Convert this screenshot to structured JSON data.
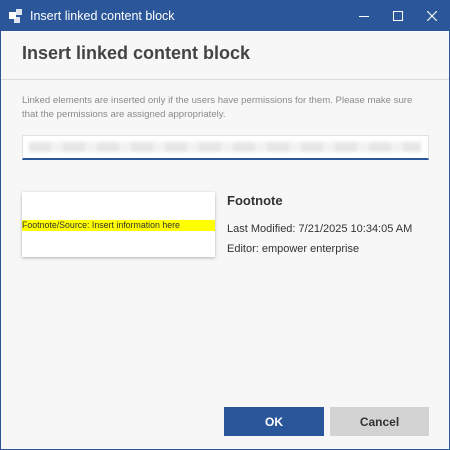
{
  "window": {
    "title": "Insert linked content block",
    "controls": [
      "minimize-icon",
      "maximize-icon",
      "close-icon"
    ]
  },
  "dialog": {
    "heading": "Insert linked content block",
    "info": "Linked elements are inserted only if the users have permissions for them. Please make sure that the permissions are assigned appropriately."
  },
  "search": {
    "value": ""
  },
  "block": {
    "preview_text": "Footnote/Source: Insert information here",
    "name": "Footnote",
    "last_modified": "Last Modified: 7/21/2025 10:34:05 AM",
    "editor": "Editor: empower enterprise"
  },
  "buttons": {
    "ok": "OK",
    "cancel": "Cancel"
  },
  "colors": {
    "accent": "#2b579a",
    "highlight": "#ffff00",
    "cancel_bg": "#d3d3d3"
  }
}
